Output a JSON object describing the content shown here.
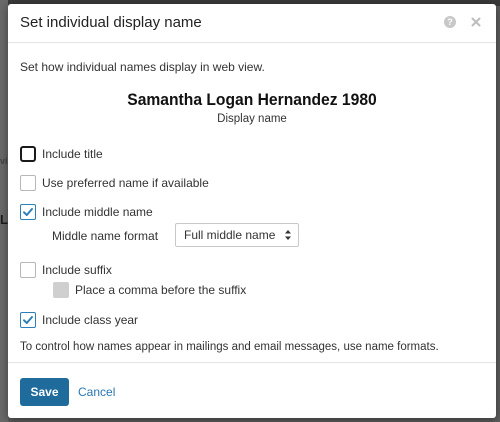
{
  "dialog": {
    "title": "Set individual display name",
    "intro": "Set how individual names display in web view.",
    "preview_name": "Samantha Logan Hernandez 1980",
    "preview_caption": "Display name",
    "options": [
      {
        "label": "Include title",
        "checked": false,
        "focused": true
      },
      {
        "label": "Use preferred name if available",
        "checked": false
      },
      {
        "label": "Include middle name",
        "checked": true
      },
      {
        "label": "Include suffix",
        "checked": false
      },
      {
        "label": "Place a comma before the suffix",
        "checked": false,
        "disabled": true
      },
      {
        "label": "Include class year",
        "checked": true
      }
    ],
    "middle_name_format_label": "Middle name format",
    "middle_name_format_value": "Full middle name",
    "note": "To control how names appear in mailings and email messages, use name formats.",
    "save_label": "Save",
    "cancel_label": "Cancel"
  },
  "colors": {
    "accent": "#1f6b9b",
    "link": "#2a77b3",
    "check": "#2c7fb8"
  },
  "background": {
    "fragments": [
      "vi",
      "L"
    ]
  }
}
